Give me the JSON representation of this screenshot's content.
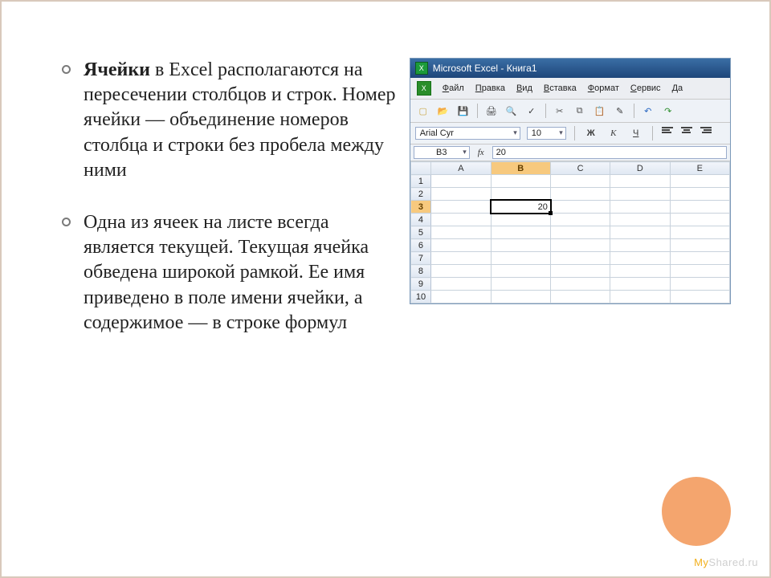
{
  "bullets": {
    "item1_strong": "Ячейки",
    "item1_rest": " в Excel располагаются на пересечении столбцов и строк. Номер ячейки — объединение номеров столбца и строки без пробела между ними",
    "item2": "Одна из ячеек на листе всегда является текущей. Текущая ячейка обведена широкой рамкой. Ее имя приведено в поле имени ячейки, а содержимое — в строке формул"
  },
  "excel": {
    "title": "Microsoft Excel - Книга1",
    "menu": {
      "file": "Файл",
      "edit": "Правка",
      "view": "Вид",
      "insert": "Вставка",
      "format": "Формат",
      "tools": "Сервис",
      "data": "Да"
    },
    "font_name": "Arial Cyr",
    "font_size": "10",
    "style": {
      "bold": "Ж",
      "italic": "К",
      "underline": "Ч"
    },
    "namebox": "B3",
    "fx_label": "fx",
    "formula_value": "20",
    "columns": [
      "A",
      "B",
      "C",
      "D",
      "E"
    ],
    "rows": [
      "1",
      "2",
      "3",
      "4",
      "5",
      "6",
      "7",
      "8",
      "9",
      "10"
    ],
    "selected_cell_value": "20",
    "app_icon_letter": "X"
  },
  "watermark": {
    "my": "My",
    "rest": "Shared.ru"
  }
}
